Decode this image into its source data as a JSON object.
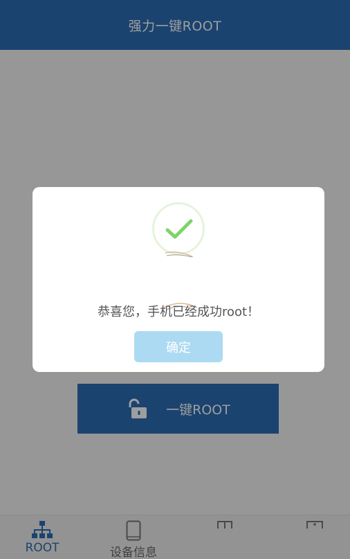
{
  "header": {
    "title": "强力一键ROOT"
  },
  "main": {
    "root_button_label": "一键ROOT"
  },
  "bottom_nav": {
    "items": [
      {
        "label": "ROOT",
        "icon": "network-tree-icon",
        "active": true
      },
      {
        "label": "设备信息",
        "icon": "phone-icon",
        "active": false
      },
      {
        "label": "",
        "icon": "tab3-icon",
        "active": false
      },
      {
        "label": "",
        "icon": "tab4-icon",
        "active": false
      }
    ]
  },
  "dialog": {
    "icon": "success-check-icon",
    "message": "恭喜您，手机已经成功root！",
    "confirm_label": "确定"
  },
  "colors": {
    "primary": "#2a6db5",
    "success_green": "#7fd36b",
    "confirm_button": "#acdaf2",
    "overlay": "rgba(0,0,0,0.38)"
  }
}
